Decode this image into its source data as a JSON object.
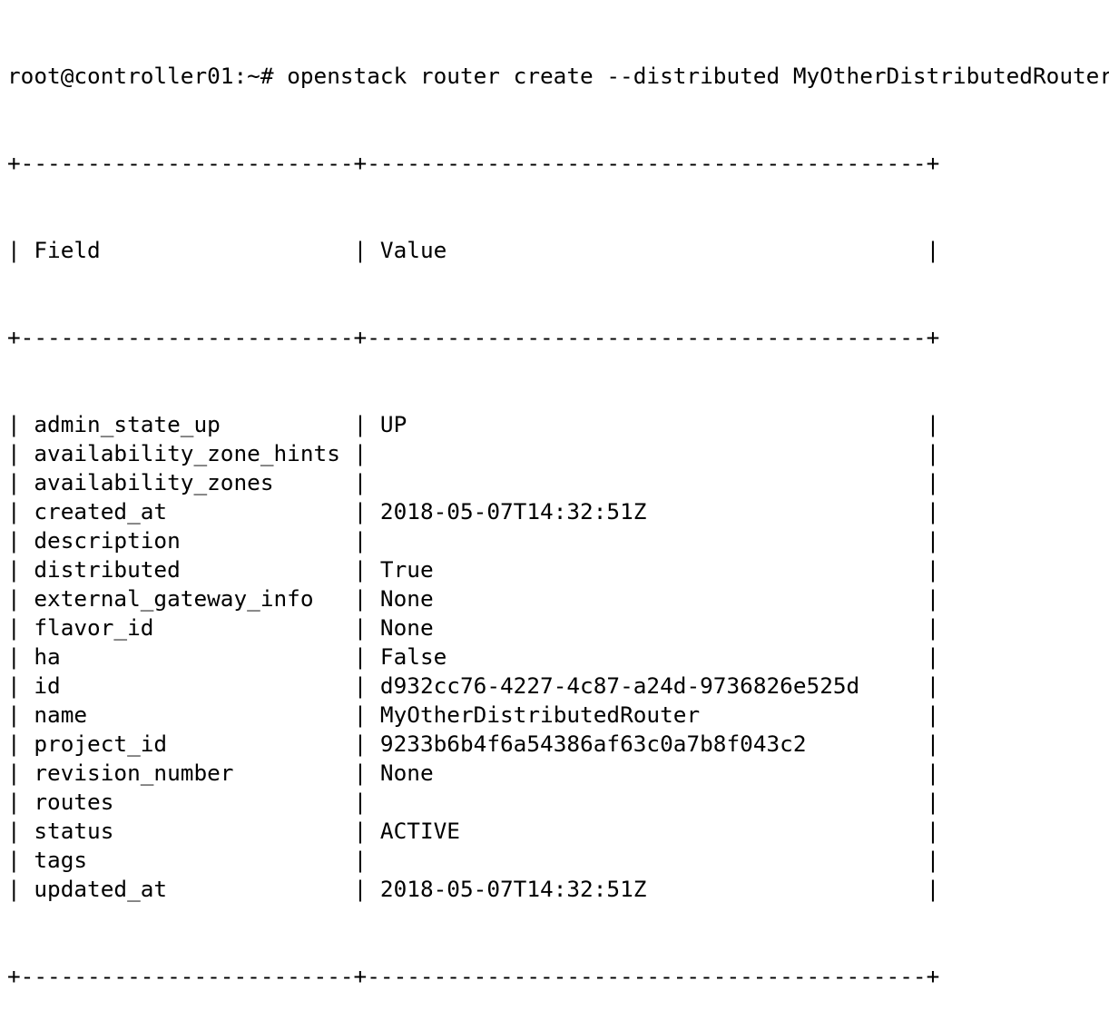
{
  "terminal": {
    "prompt": "root@controller01:~#",
    "command": "openstack router create --distributed MyOtherDistributedRouter"
  },
  "table": {
    "border_line": "+-------------------------+------------------------------------------+",
    "headers": {
      "field": "Field",
      "value": "Value"
    },
    "rows": [
      {
        "field": "admin_state_up",
        "value": "UP"
      },
      {
        "field": "availability_zone_hints",
        "value": ""
      },
      {
        "field": "availability_zones",
        "value": ""
      },
      {
        "field": "created_at",
        "value": "2018-05-07T14:32:51Z"
      },
      {
        "field": "description",
        "value": ""
      },
      {
        "field": "distributed",
        "value": "True"
      },
      {
        "field": "external_gateway_info",
        "value": "None"
      },
      {
        "field": "flavor_id",
        "value": "None"
      },
      {
        "field": "ha",
        "value": "False"
      },
      {
        "field": "id",
        "value": "d932cc76-4227-4c87-a24d-9736826e525d"
      },
      {
        "field": "name",
        "value": "MyOtherDistributedRouter"
      },
      {
        "field": "project_id",
        "value": "9233b6b4f6a54386af63c0a7b8f043c2"
      },
      {
        "field": "revision_number",
        "value": "None"
      },
      {
        "field": "routes",
        "value": ""
      },
      {
        "field": "status",
        "value": "ACTIVE"
      },
      {
        "field": "tags",
        "value": ""
      },
      {
        "field": "updated_at",
        "value": "2018-05-07T14:32:51Z"
      }
    ]
  }
}
